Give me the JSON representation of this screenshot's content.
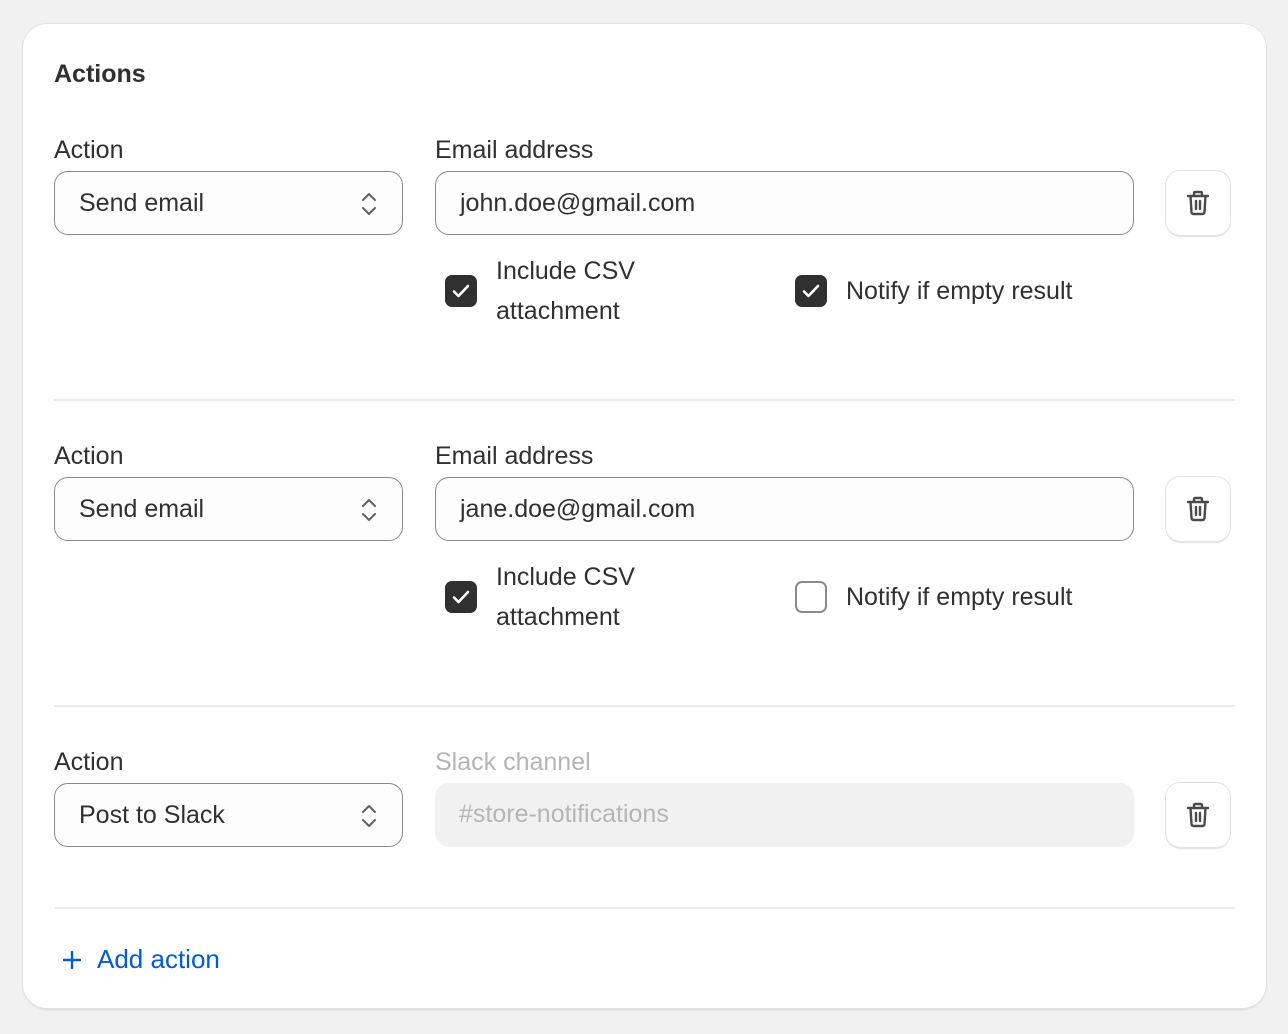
{
  "card": {
    "title": "Actions",
    "add_action_label": "Add action"
  },
  "actions": [
    {
      "action_label": "Action",
      "action_value": "Send email",
      "field_label": "Email address",
      "field_value": "john.doe@gmail.com",
      "field_disabled": false,
      "checkboxes": [
        {
          "label": "Include CSV attachment",
          "checked": true
        },
        {
          "label": "Notify if empty result",
          "checked": true
        }
      ]
    },
    {
      "action_label": "Action",
      "action_value": "Send email",
      "field_label": "Email address",
      "field_value": "jane.doe@gmail.com",
      "field_disabled": false,
      "checkboxes": [
        {
          "label": "Include CSV attachment",
          "checked": true
        },
        {
          "label": "Notify if empty result",
          "checked": false
        }
      ]
    },
    {
      "action_label": "Action",
      "action_value": "Post to Slack",
      "field_label": "Slack channel",
      "field_placeholder": "#store-notifications",
      "field_disabled": true
    }
  ],
  "icons": {
    "select": "chevron-up-down-icon",
    "delete": "trash-icon",
    "checkbox": "checkmark-icon",
    "add": "plus-icon"
  },
  "colors": {
    "link": "#005bd3",
    "checkbox_checked": "#303030",
    "disabled_text": "#b5b5b5"
  }
}
